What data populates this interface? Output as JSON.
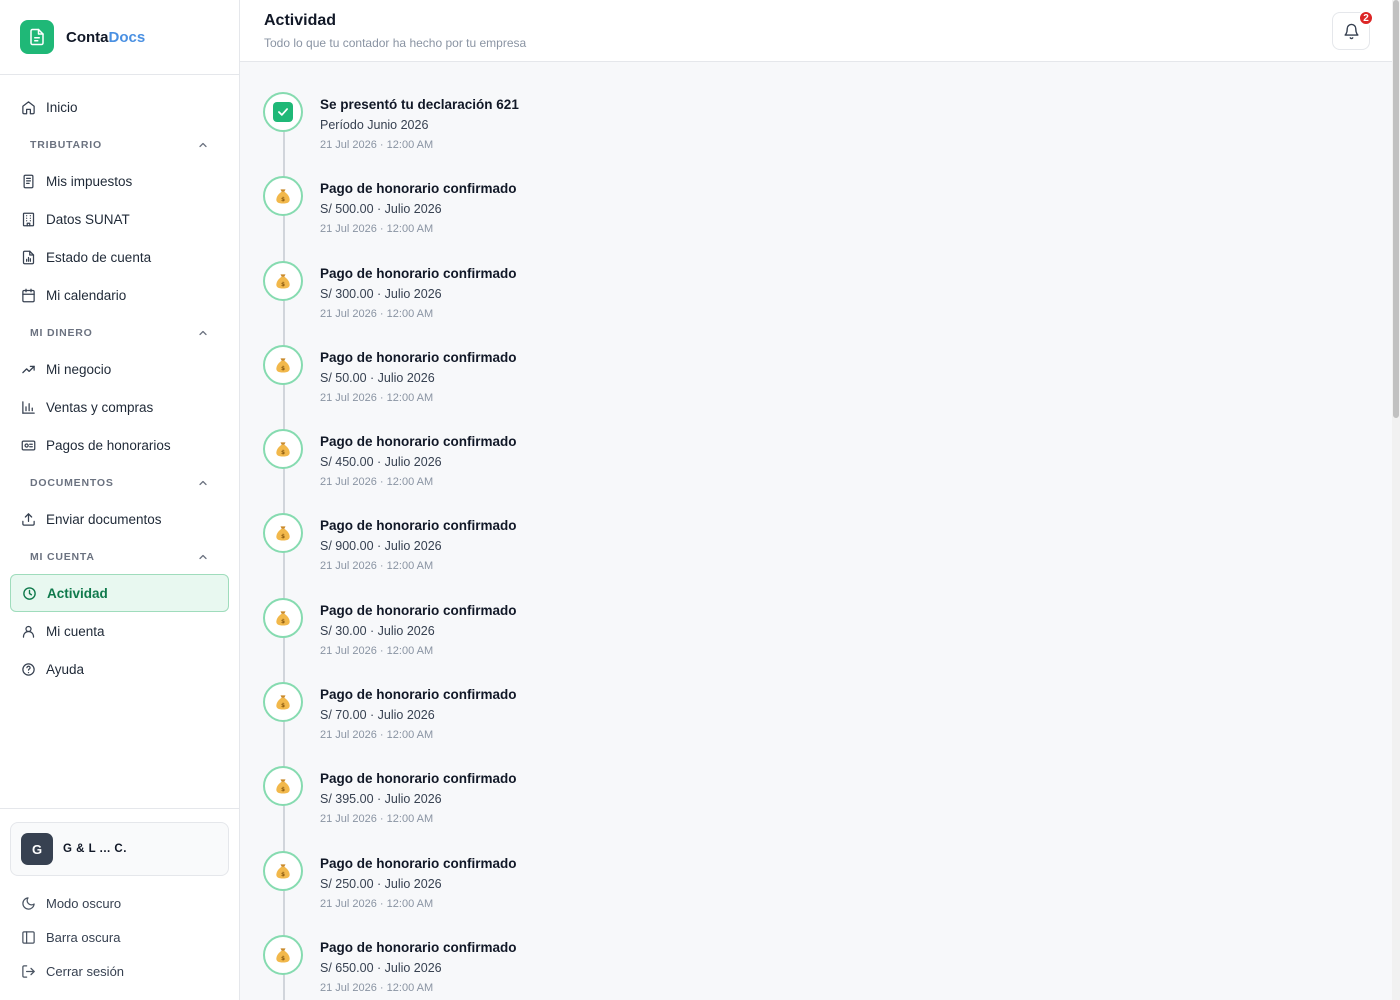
{
  "brand": {
    "name_part1": "Conta",
    "name_part2": "Docs"
  },
  "nav": {
    "home": "Inicio",
    "sections": [
      {
        "label": "TRIBUTARIO",
        "items": [
          "Mis impuestos",
          "Datos SUNAT",
          "Estado de cuenta",
          "Mi calendario"
        ]
      },
      {
        "label": "MI DINERO",
        "items": [
          "Mi negocio",
          "Ventas y compras",
          "Pagos de honorarios"
        ]
      },
      {
        "label": "DOCUMENTOS",
        "items": [
          "Enviar documentos"
        ]
      },
      {
        "label": "MI CUENTA",
        "items": [
          "Actividad",
          "Mi cuenta",
          "Ayuda"
        ]
      }
    ]
  },
  "company": {
    "initial": "G",
    "name": "G & L ... C."
  },
  "bottom": {
    "dark_mode": "Modo oscuro",
    "dark_bar": "Barra oscura",
    "logout": "Cerrar sesión"
  },
  "header": {
    "title": "Actividad",
    "subtitle": "Todo lo que tu contador ha hecho por tu empresa",
    "notifications": "2"
  },
  "colors": {
    "accent": "#1fb877",
    "active_bg": "#e8f8f0",
    "badge": "#dc2626",
    "brand_blue": "#4a90e2"
  },
  "timeline": [
    {
      "icon": "check-icon",
      "title": "Se presentó tu declaración 621",
      "detail": "Período Junio 2026",
      "time": "21 Jul 2026 · 12:00 AM"
    },
    {
      "icon": "money-bag-icon",
      "title": "Pago de honorario confirmado",
      "detail": "S/ 500.00 · Julio 2026",
      "time": "21 Jul 2026 · 12:00 AM"
    },
    {
      "icon": "money-bag-icon",
      "title": "Pago de honorario confirmado",
      "detail": "S/ 300.00 · Julio 2026",
      "time": "21 Jul 2026 · 12:00 AM"
    },
    {
      "icon": "money-bag-icon",
      "title": "Pago de honorario confirmado",
      "detail": "S/ 50.00 · Julio 2026",
      "time": "21 Jul 2026 · 12:00 AM"
    },
    {
      "icon": "money-bag-icon",
      "title": "Pago de honorario confirmado",
      "detail": "S/ 450.00 · Julio 2026",
      "time": "21 Jul 2026 · 12:00 AM"
    },
    {
      "icon": "money-bag-icon",
      "title": "Pago de honorario confirmado",
      "detail": "S/ 900.00 · Julio 2026",
      "time": "21 Jul 2026 · 12:00 AM"
    },
    {
      "icon": "money-bag-icon",
      "title": "Pago de honorario confirmado",
      "detail": "S/ 30.00 · Julio 2026",
      "time": "21 Jul 2026 · 12:00 AM"
    },
    {
      "icon": "money-bag-icon",
      "title": "Pago de honorario confirmado",
      "detail": "S/ 70.00 · Julio 2026",
      "time": "21 Jul 2026 · 12:00 AM"
    },
    {
      "icon": "money-bag-icon",
      "title": "Pago de honorario confirmado",
      "detail": "S/ 395.00 · Julio 2026",
      "time": "21 Jul 2026 · 12:00 AM"
    },
    {
      "icon": "money-bag-icon",
      "title": "Pago de honorario confirmado",
      "detail": "S/ 250.00 · Julio 2026",
      "time": "21 Jul 2026 · 12:00 AM"
    },
    {
      "icon": "money-bag-icon",
      "title": "Pago de honorario confirmado",
      "detail": "S/ 650.00 · Julio 2026",
      "time": "21 Jul 2026 · 12:00 AM"
    }
  ]
}
